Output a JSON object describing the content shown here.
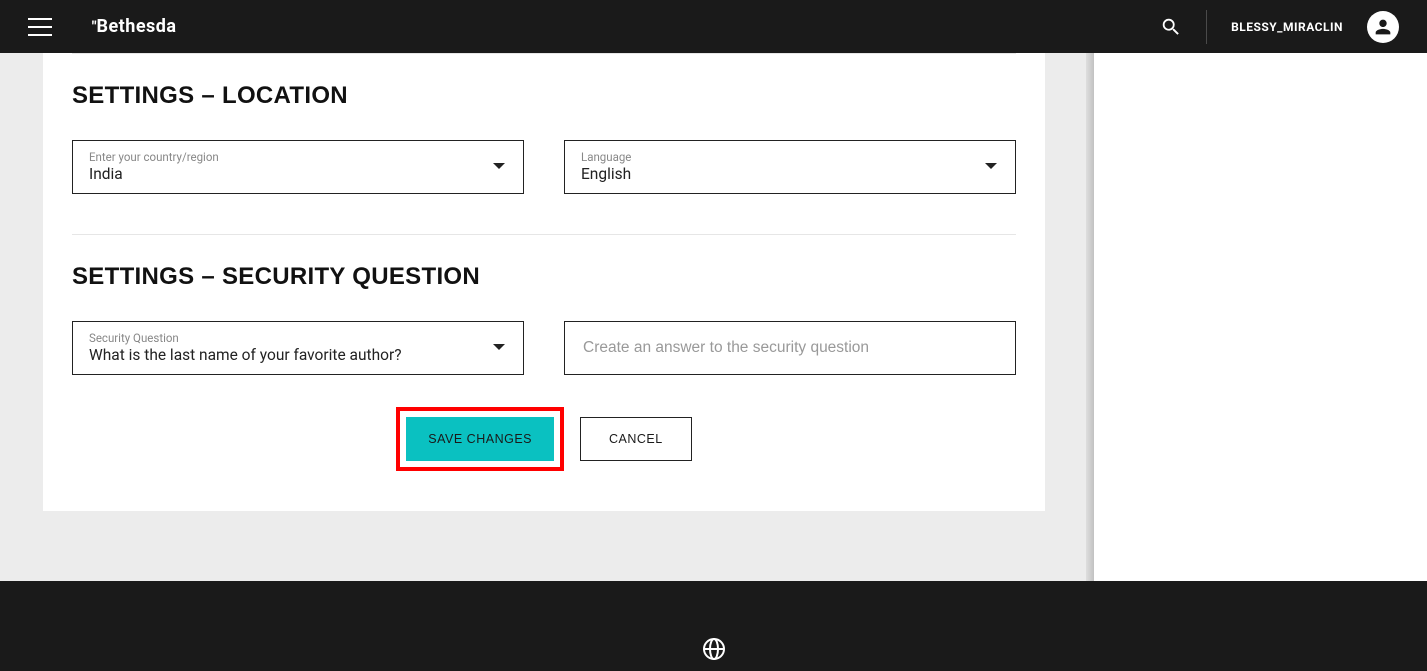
{
  "header": {
    "brand": "Bethesda",
    "username": "BLESSY_MIRACLIN"
  },
  "sections": {
    "location": {
      "title": "SETTINGS – LOCATION",
      "country": {
        "label": "Enter your country/region",
        "value": "India"
      },
      "language": {
        "label": "Language",
        "value": "English"
      }
    },
    "security": {
      "title": "SETTINGS – SECURITY QUESTION",
      "question": {
        "label": "Security Question",
        "value": "What is the last name of your favorite author?"
      },
      "answer": {
        "placeholder": "Create an answer to the security question",
        "value": ""
      }
    }
  },
  "actions": {
    "save": "SAVE CHANGES",
    "cancel": "CANCEL"
  }
}
